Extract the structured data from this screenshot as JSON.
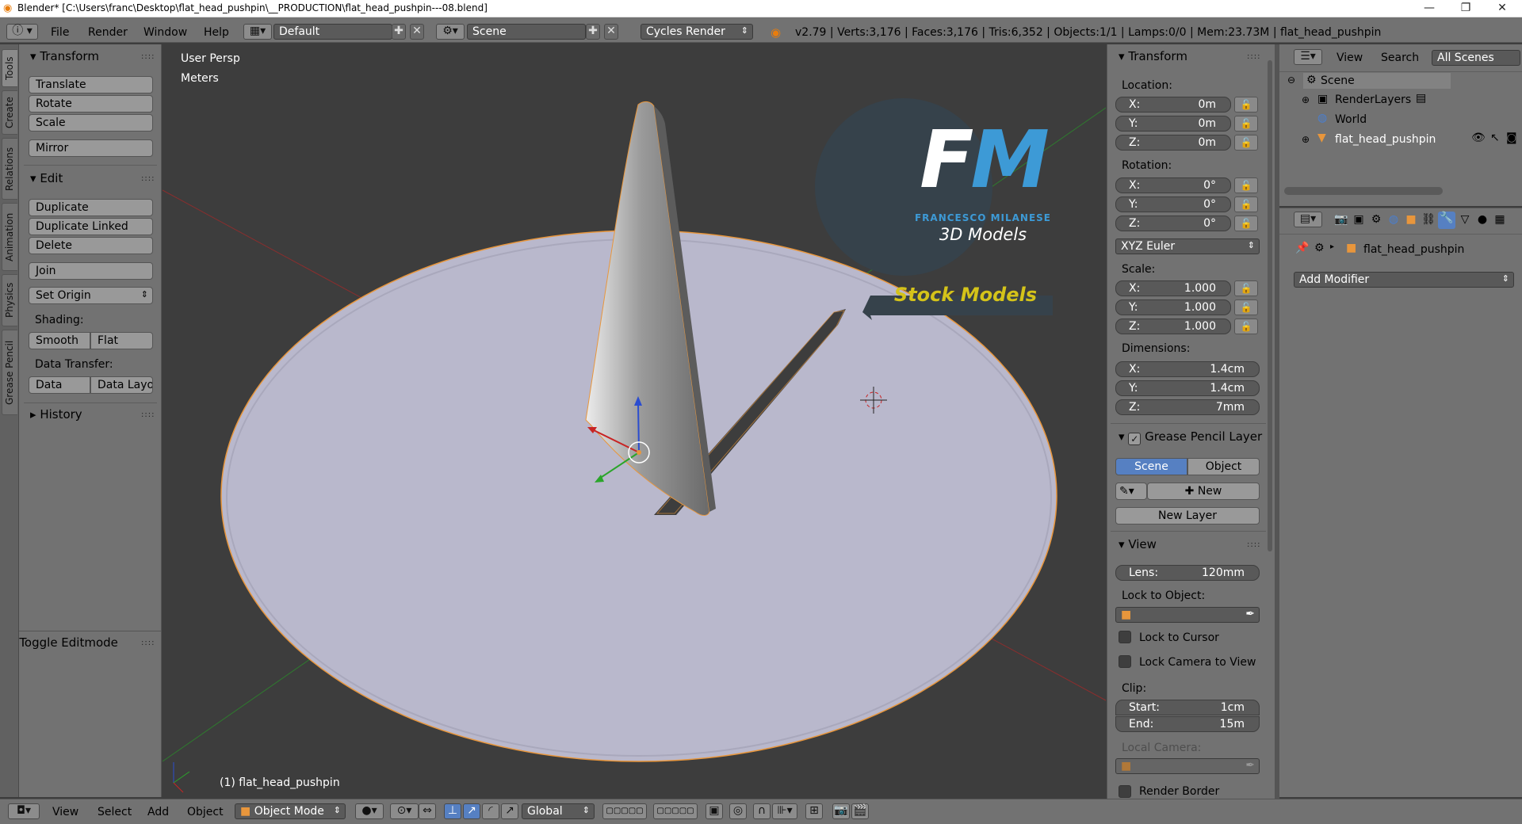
{
  "window": {
    "title": "Blender* [C:\\Users\\franc\\Desktop\\flat_head_pushpin\\__PRODUCTION\\flat_head_pushpin---08.blend]",
    "minimize": "—",
    "maximize": "❐",
    "close": "✕"
  },
  "infobar": {
    "menus": [
      "File",
      "Render",
      "Window",
      "Help"
    ],
    "layout": "Default",
    "scene": "Scene",
    "render_engine": "Cycles Render",
    "stats": "v2.79 | Verts:3,176 | Faces:3,176 | Tris:6,352 | Objects:1/1 | Lamps:0/0 | Mem:23.73M | flat_head_pushpin"
  },
  "tool_tabs": [
    "Tools",
    "Create",
    "Relations",
    "Animation",
    "Physics",
    "Grease Pencil"
  ],
  "toolshelf": {
    "transform": {
      "title": "Transform",
      "translate": "Translate",
      "rotate": "Rotate",
      "scale": "Scale",
      "mirror": "Mirror"
    },
    "edit": {
      "title": "Edit",
      "duplicate": "Duplicate",
      "duplicate_linked": "Duplicate Linked",
      "delete": "Delete",
      "join": "Join",
      "set_origin": "Set Origin",
      "shading_label": "Shading:",
      "smooth": "Smooth",
      "flat": "Flat",
      "data_transfer_label": "Data Transfer:",
      "data": "Data",
      "data_layo": "Data Layo"
    },
    "history": "History",
    "toggle_editmode": "Toggle Editmode"
  },
  "viewport": {
    "view_name": "User Persp",
    "units": "Meters",
    "active_object": "(1) flat_head_pushpin",
    "watermark": {
      "initials": "FM",
      "company": "FRANCESCO MILANESE",
      "subtitle": "3D Models",
      "banner": "Stock Models"
    }
  },
  "npanel": {
    "transform_title": "Transform",
    "location_label": "Location:",
    "location": [
      {
        "axis": "X:",
        "value": "0m"
      },
      {
        "axis": "Y:",
        "value": "0m"
      },
      {
        "axis": "Z:",
        "value": "0m"
      }
    ],
    "rotation_label": "Rotation:",
    "rotation": [
      {
        "axis": "X:",
        "value": "0°"
      },
      {
        "axis": "Y:",
        "value": "0°"
      },
      {
        "axis": "Z:",
        "value": "0°"
      }
    ],
    "rotation_mode": "XYZ Euler",
    "scale_label": "Scale:",
    "scale": [
      {
        "axis": "X:",
        "value": "1.000"
      },
      {
        "axis": "Y:",
        "value": "1.000"
      },
      {
        "axis": "Z:",
        "value": "1.000"
      }
    ],
    "dimensions_label": "Dimensions:",
    "dimensions": [
      {
        "axis": "X:",
        "value": "1.4cm"
      },
      {
        "axis": "Y:",
        "value": "1.4cm"
      },
      {
        "axis": "Z:",
        "value": "7mm"
      }
    ],
    "grease_title": "Grease Pencil Layer",
    "grease_scene": "Scene",
    "grease_object": "Object",
    "grease_new": "New",
    "grease_new_layer": "New Layer",
    "view_title": "View",
    "lens_label": "Lens:",
    "lens_value": "120mm",
    "lock_to_object": "Lock to Object:",
    "lock_to_cursor": "Lock to Cursor",
    "lock_camera": "Lock Camera to View",
    "clip_label": "Clip:",
    "clip_start_label": "Start:",
    "clip_start": "1cm",
    "clip_end_label": "End:",
    "clip_end": "15m",
    "local_camera": "Local Camera:",
    "render_border": "Render Border"
  },
  "outliner": {
    "menus": [
      "View",
      "Search"
    ],
    "display": "All Scenes",
    "tree": [
      "Scene",
      "RenderLayers",
      "World",
      "flat_head_pushpin"
    ]
  },
  "properties": {
    "object_name": "flat_head_pushpin",
    "add_modifier": "Add Modifier"
  },
  "bottombar": {
    "menus": [
      "View",
      "Select",
      "Add",
      "Object"
    ],
    "mode": "Object Mode",
    "orientation": "Global"
  },
  "colors": {
    "panel": "#727272",
    "viewport": "#3d3d3d",
    "accent_blue": "#5680c2",
    "object_fill": "#b9b8cc",
    "selection_outline": "#e8963c",
    "banner_text": "#d4c31a",
    "logo_blue": "#3d9ad6"
  }
}
